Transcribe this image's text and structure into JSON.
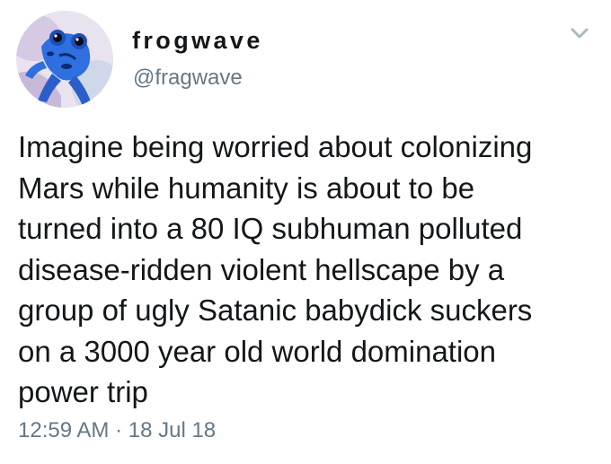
{
  "tweet": {
    "author": {
      "display_name": "frogwave",
      "handle": "@fragwave"
    },
    "text": "Imagine being worried about colonizing\nMars while humanity is about to be\nturned into a 80 IQ subhuman polluted\ndisease-ridden violent hellscape by a\ngroup of ugly Satanic babydick suckers\non a 3000 year old world domination\npower trip",
    "time": "12:59 AM",
    "separator": "·",
    "date": "18 Jul 18"
  },
  "icons": {
    "avatar": "blue-frog-avatar",
    "menu": "chevron-down-icon"
  },
  "colors": {
    "text_primary": "#14171a",
    "text_secondary": "#657786",
    "caret": "#aab8c2",
    "frog_blue": "#2f6fe0"
  }
}
